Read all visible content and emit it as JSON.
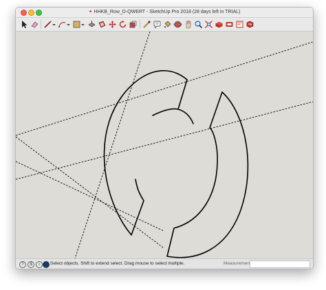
{
  "window": {
    "title": "HHKB_Row_D-QWERT - SketchUp Pro 2018 (28 days left in TRIAL)"
  },
  "toolbar": {
    "tools": [
      "select-tool",
      "eraser-tool",
      "line-tool",
      "arc-tool",
      "shape-tool",
      "push-pull-tool",
      "offset-tool",
      "move-tool",
      "rotate-tool",
      "scale-tool",
      "tape-measure-tool",
      "text-tool",
      "paint-bucket-tool",
      "orbit-tool",
      "pan-tool",
      "zoom-tool",
      "zoom-extents-tool",
      "3d-warehouse-tool",
      "extension-warehouse-tool",
      "layout-tool",
      "extension-manager-tool"
    ]
  },
  "status": {
    "hint": "Select objects. Shift to extend select. Drag mouse to select multiple.",
    "measurements_label": "Measurements",
    "measurements_value": ""
  },
  "colors": {
    "canvas": "#dddcd6",
    "geometry_stroke": "#000000",
    "guide_stroke": "#000000"
  }
}
